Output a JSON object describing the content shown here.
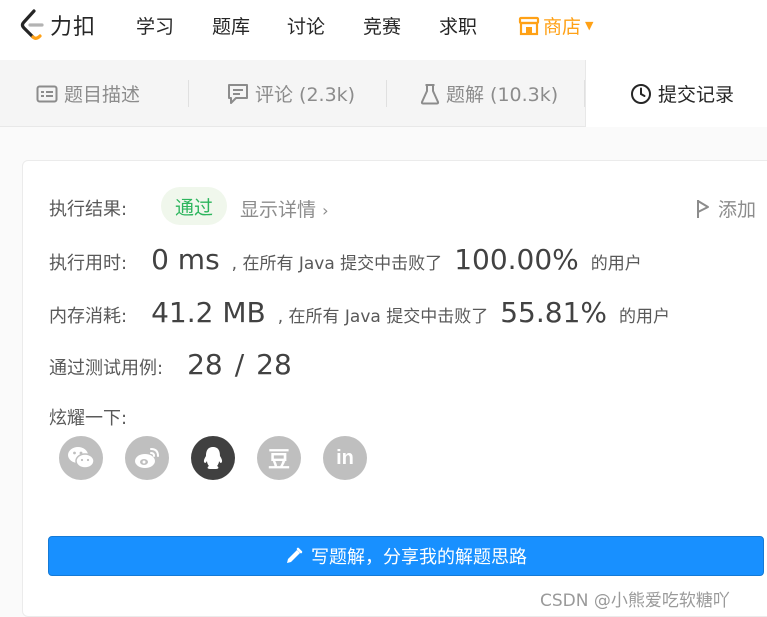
{
  "logo": {
    "text": "力扣"
  },
  "nav": {
    "items": [
      "学习",
      "题库",
      "讨论",
      "竞赛",
      "求职"
    ],
    "shop_label": "商店",
    "shop_color": "#ffa116"
  },
  "tabs": [
    {
      "label": "题目描述",
      "icon": "description-icon"
    },
    {
      "label": "评论 (2.3k)",
      "icon": "comment-icon"
    },
    {
      "label": "题解 (10.3k)",
      "icon": "flask-icon"
    },
    {
      "label": "提交记录",
      "icon": "clock-icon",
      "active": true
    }
  ],
  "result": {
    "label": "执行结果:",
    "status": "通过",
    "status_color": "#2db55d",
    "details_label": "显示详情",
    "add_note_label": "添加"
  },
  "runtime": {
    "label": "执行用时:",
    "value": "0 ms",
    "middle": ", 在所有 Java 提交中击败了",
    "percent": "100.00%",
    "suffix": "的用户"
  },
  "memory": {
    "label": "内存消耗:",
    "value": "41.2 MB",
    "middle": ", 在所有 Java 提交中击败了",
    "percent": "55.81%",
    "suffix": "的用户"
  },
  "testcases": {
    "label": "通过测试用例:",
    "passed": "28",
    "separator": "/",
    "total": "28"
  },
  "share": {
    "label": "炫耀一下:",
    "icons": [
      "wechat-icon",
      "weibo-icon",
      "qq-icon",
      "douban-icon",
      "linkedin-icon"
    ],
    "douban_glyph": "豆",
    "linkedin_glyph": "in"
  },
  "write_button": {
    "label": "写题解，分享我的解题思路",
    "color": "#1890ff"
  },
  "watermark": "CSDN @小熊爱吃软糖吖"
}
